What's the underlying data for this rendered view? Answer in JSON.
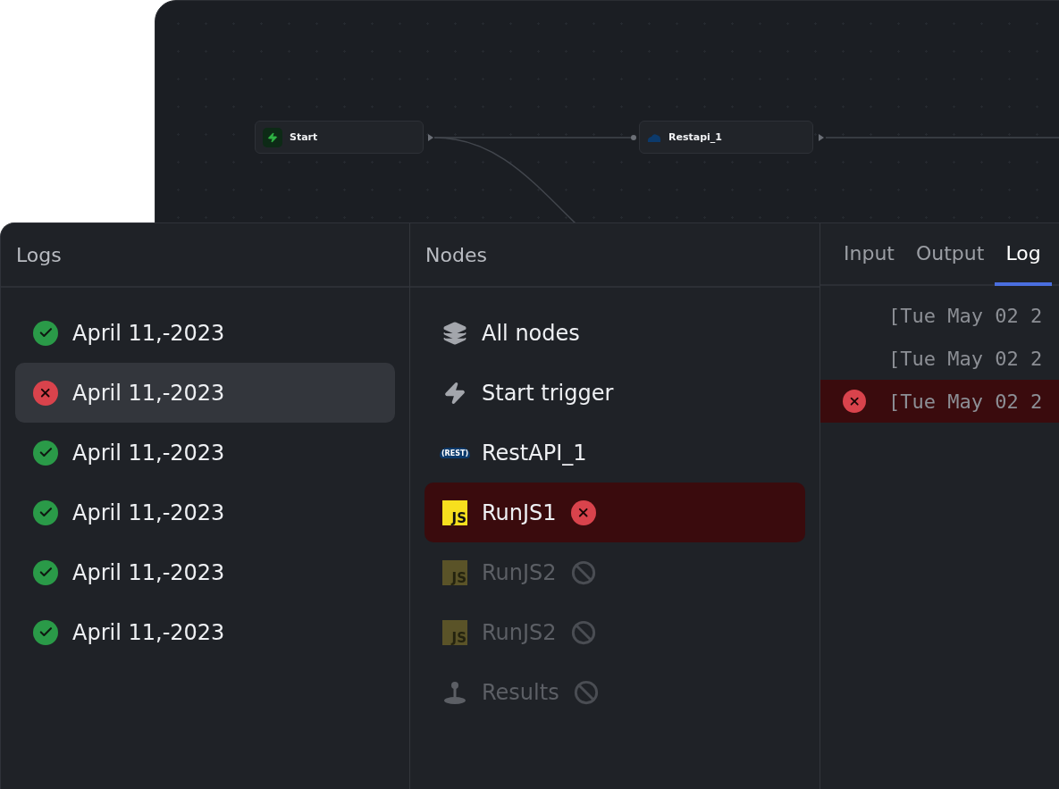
{
  "canvas": {
    "nodes": [
      {
        "label": "Start",
        "kind": "trigger"
      },
      {
        "label": "Restapi_1",
        "kind": "rest"
      }
    ]
  },
  "logs_panel": {
    "title": "Logs",
    "items": [
      {
        "label": "April 11,-2023",
        "success": true,
        "selected": false
      },
      {
        "label": "April 11,-2023",
        "success": false,
        "selected": true
      },
      {
        "label": "April 11,-2023",
        "success": true,
        "selected": false
      },
      {
        "label": "April 11,-2023",
        "success": true,
        "selected": false
      },
      {
        "label": "April 11,-2023",
        "success": true,
        "selected": false
      },
      {
        "label": "April 11,-2023",
        "success": true,
        "selected": false
      }
    ]
  },
  "nodes_panel": {
    "title": "Nodes",
    "items": [
      {
        "label": "All nodes",
        "kind": "layers",
        "error": false,
        "skipped": false
      },
      {
        "label": "Start trigger",
        "kind": "trigger",
        "error": false,
        "skipped": false
      },
      {
        "label": "RestAPI_1",
        "kind": "rest",
        "icon_text": "(REST)",
        "error": false,
        "skipped": false
      },
      {
        "label": "RunJS1",
        "kind": "js",
        "icon_text": "JS",
        "error": true,
        "skipped": false
      },
      {
        "label": "RunJS2",
        "kind": "js",
        "icon_text": "JS",
        "error": false,
        "skipped": true
      },
      {
        "label": "RunJS2",
        "kind": "js",
        "icon_text": "JS",
        "error": false,
        "skipped": true
      },
      {
        "label": "Results",
        "kind": "output",
        "error": false,
        "skipped": true
      }
    ]
  },
  "detail": {
    "tabs": [
      {
        "label": "Input",
        "selected": false
      },
      {
        "label": "Output",
        "selected": false
      },
      {
        "label": "Log",
        "selected": true
      }
    ],
    "lines": [
      {
        "text": "[Tue May 02 2",
        "error": false
      },
      {
        "text": "[Tue May 02 2",
        "error": false
      },
      {
        "text": "[Tue May 02 2",
        "error": true
      }
    ]
  }
}
